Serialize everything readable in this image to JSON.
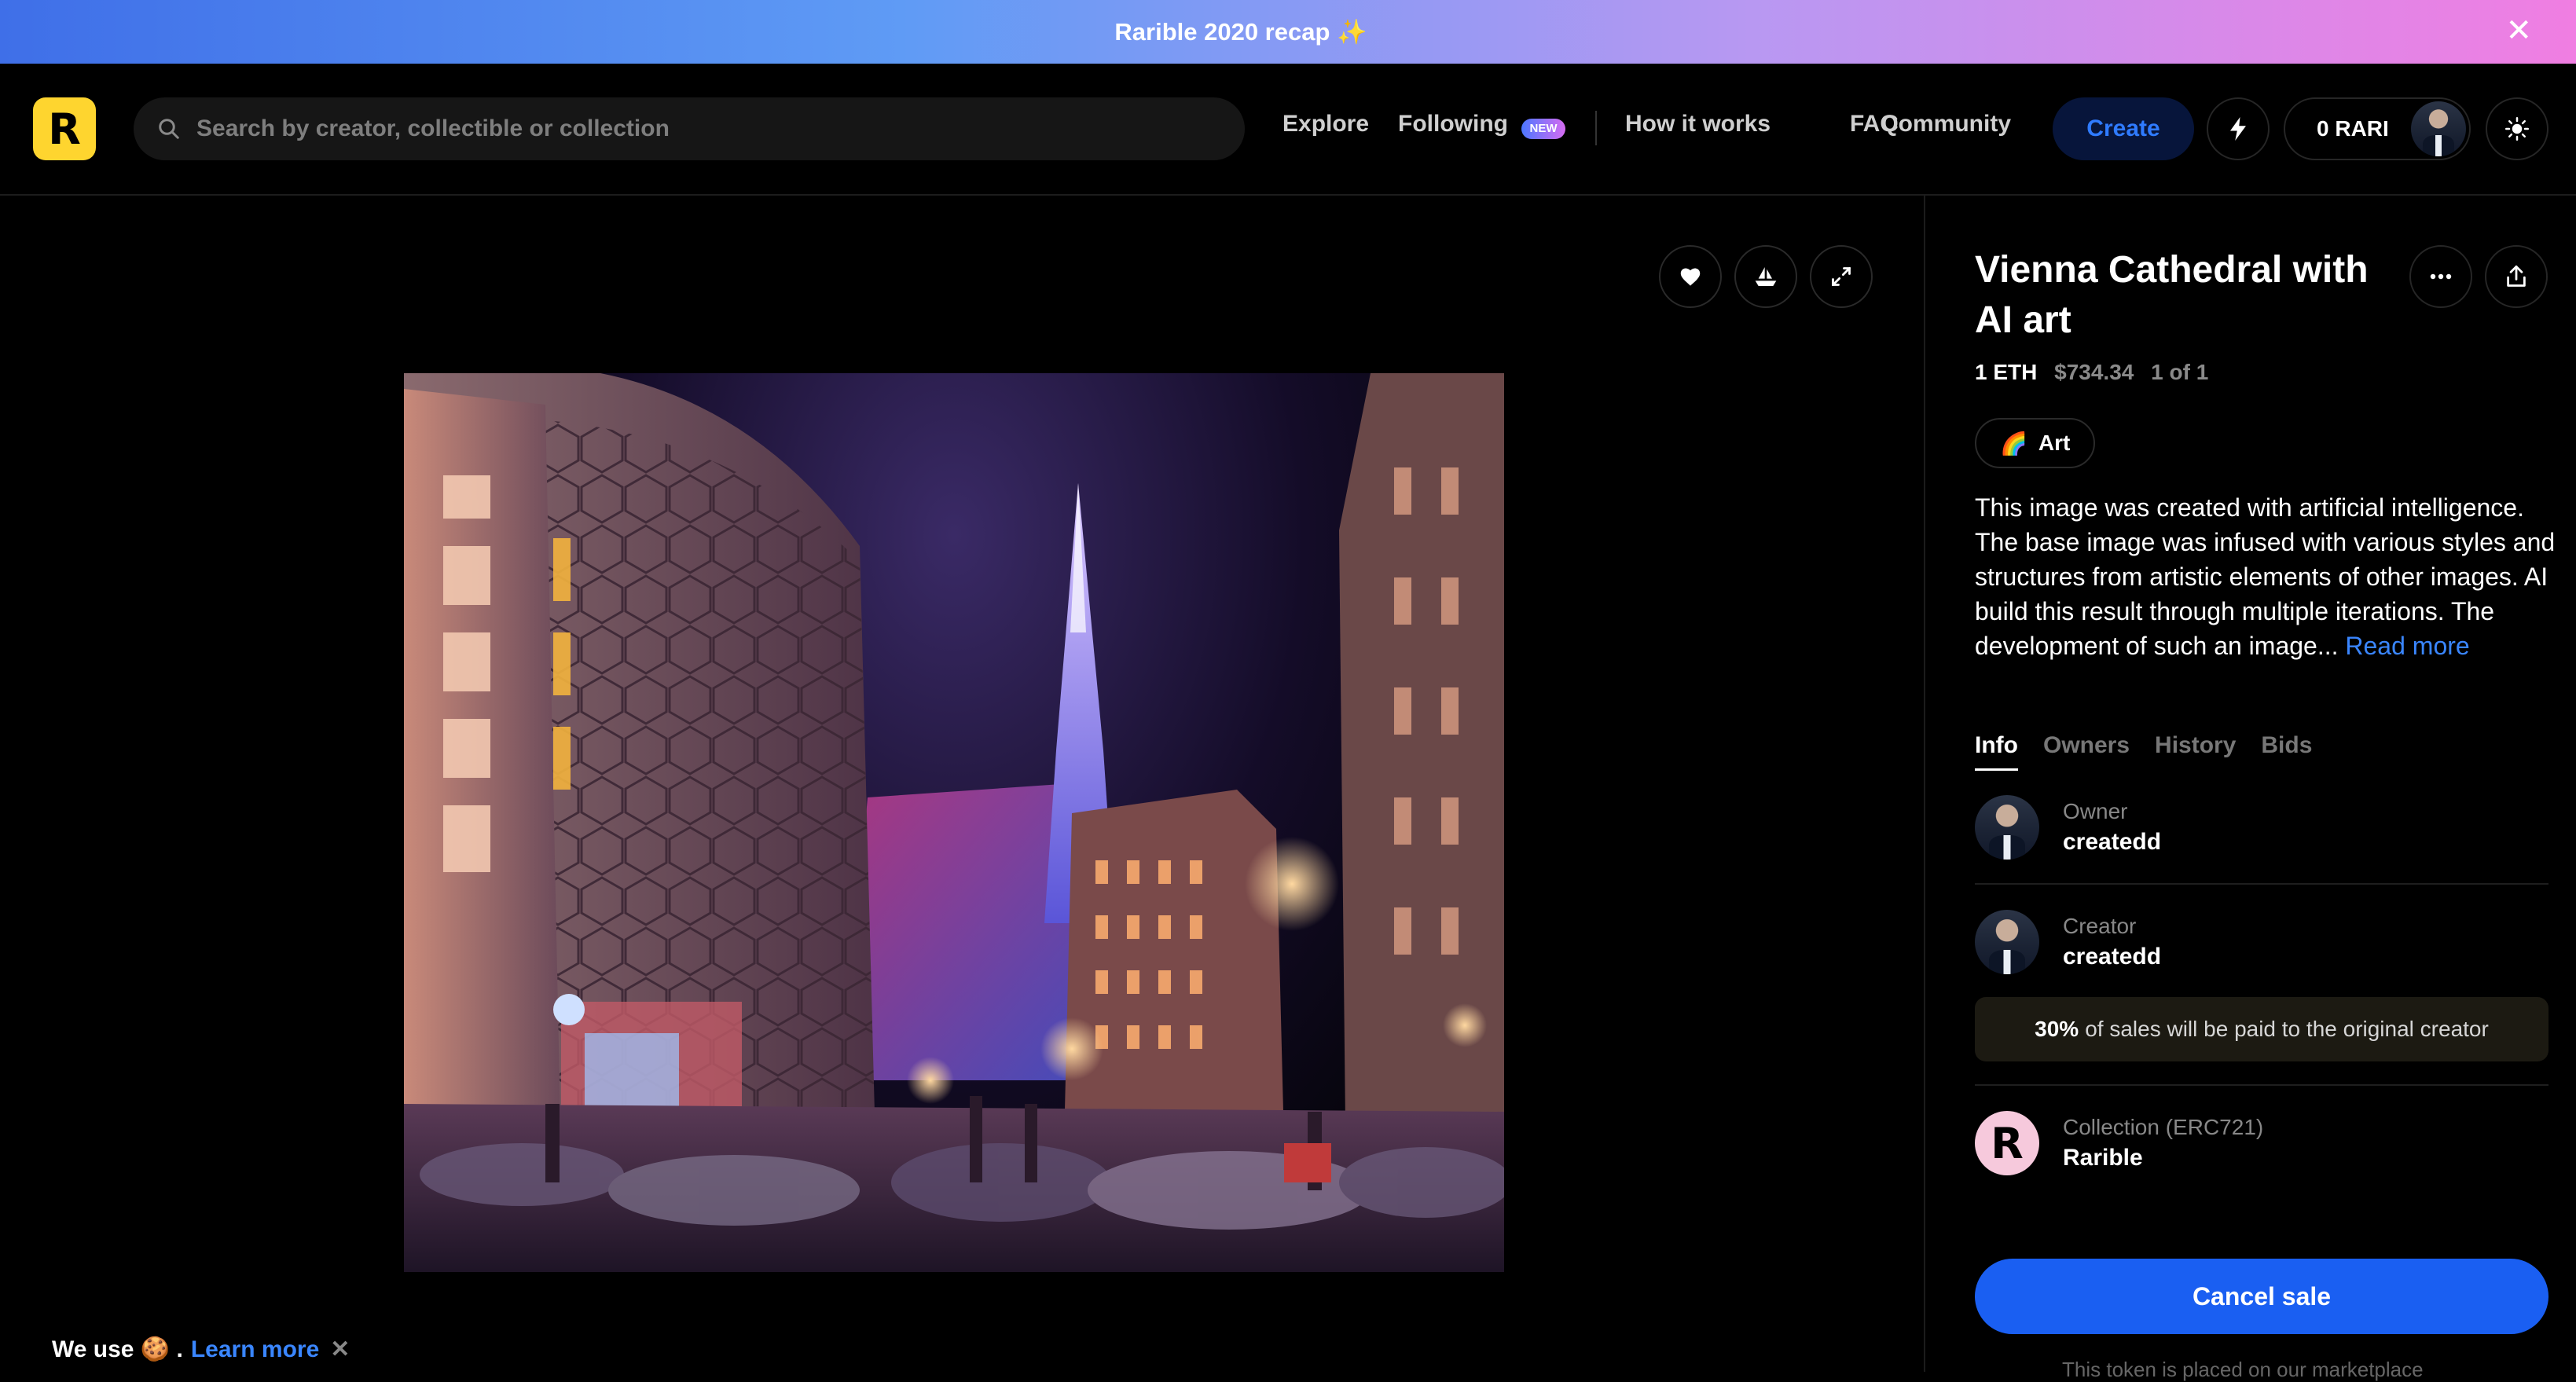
{
  "banner": {
    "text": "Rarible 2020 recap ✨",
    "close": "✕"
  },
  "header": {
    "logo_letter": "R",
    "search_placeholder": "Search by creator, collectible or collection",
    "nav": [
      "Explore",
      "Following",
      "How it works",
      "FAQ",
      "Community"
    ],
    "new_badge": "NEW",
    "create_label": "Create",
    "rari_balance": "0 RARI"
  },
  "item": {
    "title": "Vienna Cathedral with AI art",
    "price_eth": "1 ETH",
    "price_usd": "$734.34",
    "edition": "1 of 1",
    "tag_emoji": "🌈",
    "tag_label": "Art",
    "description": "This image was created with artificial intelligence. The base image was infused with various styles and structures from artistic elements of other images. AI build this result through multiple iterations. The development of such an image...",
    "read_more": "Read more",
    "tabs": [
      "Info",
      "Owners",
      "History",
      "Bids"
    ],
    "owner": {
      "role": "Owner",
      "name": "createdd"
    },
    "creator": {
      "role": "Creator",
      "name": "createdd"
    },
    "royalty_percent": "30%",
    "royalty_text": "of sales will be paid to the original creator",
    "collection": {
      "role": "Collection (ERC721)",
      "name": "Rarible",
      "icon_letter": "R"
    },
    "cancel_label": "Cancel sale",
    "note": "This token is placed on our marketplace"
  },
  "cookie": {
    "prefix": "We use 🍪 .",
    "learn_more": "Learn more",
    "close": "✕"
  },
  "colors": {
    "accent": "#1a5ff2",
    "link": "#3a86ff",
    "logo": "#fed52f"
  }
}
